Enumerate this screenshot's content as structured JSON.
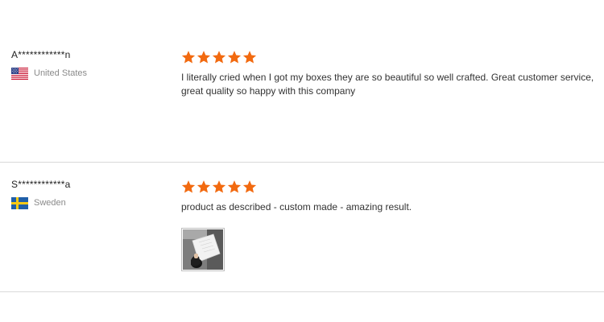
{
  "reviews": [
    {
      "reviewer_name": "A************n",
      "country": "United States",
      "flag_icon": "us-flag-icon",
      "rating": 5,
      "rating_max": 5,
      "star_color": "#f26a10",
      "text": "I literally cried when I got my boxes they are so beautiful so well crafted. Great customer service, great quality so happy with this company"
    },
    {
      "reviewer_name": "S************a",
      "country": "Sweden",
      "flag_icon": "sweden-flag-icon",
      "rating": 5,
      "rating_max": 5,
      "star_color": "#f26a10",
      "text": "product as described - custom made - amazing result.",
      "photos": [
        "review-photo"
      ]
    }
  ]
}
